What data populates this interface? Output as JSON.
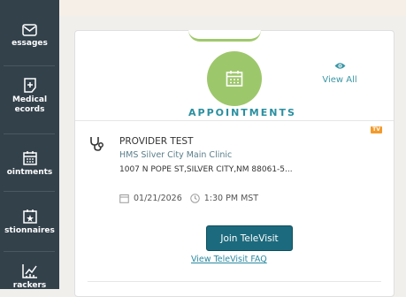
{
  "sidebar": {
    "items": [
      {
        "label": "essages",
        "icon": "envelope-icon"
      },
      {
        "label": "Medical",
        "label2": "ecords",
        "icon": "medical-records-icon"
      },
      {
        "label": "ointments",
        "icon": "calendar-icon"
      },
      {
        "label": "stionnaires",
        "icon": "questionnaire-icon"
      },
      {
        "label": "rackers",
        "icon": "chart-icon"
      }
    ]
  },
  "appointments": {
    "title": "APPOINTMENTS",
    "view_all": "View All",
    "accent_color": "#9dc76b"
  },
  "appointment": {
    "badge": "TV",
    "provider": "PROVIDER TEST",
    "clinic": "HMS Silver City Main Clinic",
    "address": "1007 N POPE ST,SILVER CITY,NM 88061-5...",
    "date": "01/21/2026",
    "time": "1:30 PM MST",
    "join_label": "Join TeleVisit",
    "faq_label": "View TeleVisit FAQ"
  }
}
